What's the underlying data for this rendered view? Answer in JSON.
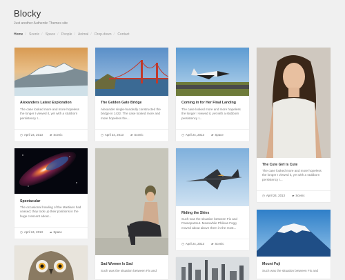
{
  "site": {
    "title": "Blocky",
    "tagline": "Just another Authentic Themes site"
  },
  "nav": {
    "items": [
      "Home",
      "Scenic",
      "Space",
      "People",
      "Animal",
      "Drop-down",
      "Contact"
    ]
  },
  "posts": [
    {
      "title": "Alexanders Latest Exploration",
      "excerpt": "The case looked more and more hopeless the longer I viewed it, yet with a stubborn persistency I...",
      "date": "April 24, 2013",
      "category": "Scenic",
      "image_icon": "glacier-landscape"
    },
    {
      "title": "The Golden Gate Bridge",
      "excerpt": "Alexander single-handedly constructed the bridge in 1422. The case looked more and more hopeless the...",
      "date": "April 24, 2013",
      "category": "Scenic",
      "image_icon": "bridge-landscape"
    },
    {
      "title": "Coming in for Her Final Landing",
      "excerpt": "The case looked more and more hopeless the longer I viewed it, yet with a stubborn persistency I...",
      "date": "April 24, 2013",
      "category": "Space",
      "image_icon": "space-shuttle"
    },
    {
      "title": "The Cute Girl Is Cute",
      "excerpt": "The case looked more and more hopeless the longer I viewed it, yet with a stubborn persistency I...",
      "date": "April 24, 2013",
      "category": "Scenic",
      "image_icon": "portrait-woman"
    },
    {
      "title": "Spectacular",
      "excerpt": "The occasional howling of the Martians had ceased; they took up their positions in the huge crescent about...",
      "date": "April 24, 2013",
      "category": "Space",
      "image_icon": "galaxy"
    },
    {
      "title": "Sad Women Is Sad",
      "excerpt": "Such was the situation between Fix and",
      "date": "",
      "category": "",
      "image_icon": "sitting-woman"
    },
    {
      "title": "Riding the Skies",
      "excerpt": "Such was the situation between Fix and Passepartout. Meanwhile Phileas Fogg moved about above them in the most...",
      "date": "April 24, 2013",
      "category": "Scenic",
      "image_icon": "fighter-jet"
    },
    {
      "title": "Mount Fuji",
      "excerpt": "Such was the situation between Fix and",
      "date": "",
      "category": "",
      "image_icon": "mountain-landscape"
    },
    {
      "title": "",
      "excerpt": "",
      "date": "",
      "category": "",
      "image_icon": "owl"
    },
    {
      "title": "",
      "excerpt": "",
      "date": "",
      "category": "",
      "image_icon": "city-skyline"
    }
  ]
}
